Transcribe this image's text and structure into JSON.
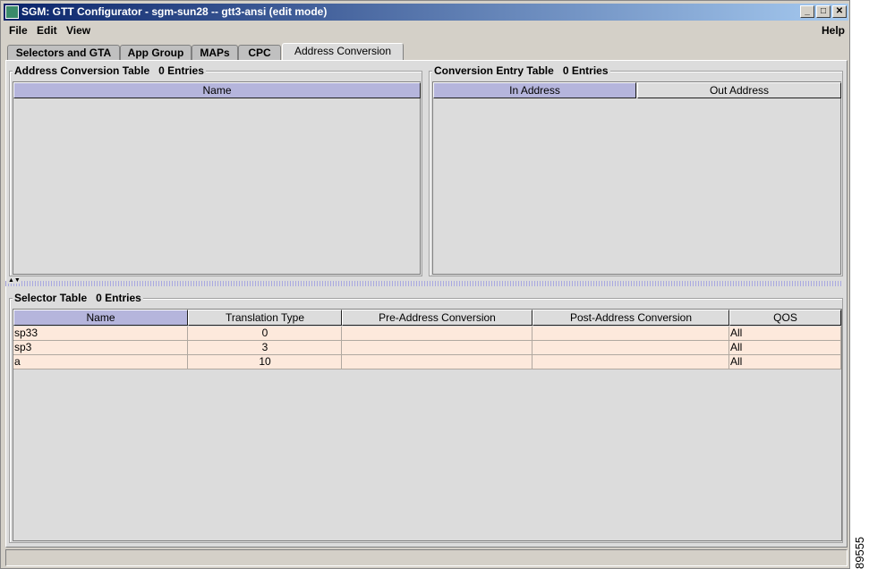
{
  "window": {
    "title": "SGM:  GTT Configurator - sgm-sun28 -- gtt3-ansi (edit mode)",
    "controls": [
      "_",
      "□",
      "✕"
    ]
  },
  "menu": {
    "file": "File",
    "edit": "Edit",
    "view": "View",
    "help": "Help"
  },
  "tabs": [
    "Selectors and GTA",
    "App Group",
    "MAPs",
    "CPC",
    "Address Conversion"
  ],
  "address_table": {
    "title": "Address Conversion Table",
    "count": "0 Entries",
    "columns": [
      "Name"
    ]
  },
  "conversion_table": {
    "title": "Conversion Entry Table",
    "count": "0 Entries",
    "columns": [
      "In Address",
      "Out Address"
    ]
  },
  "selector_table": {
    "title": "Selector Table",
    "count": "0 Entries",
    "columns": [
      "Name",
      "Translation Type",
      "Pre-Address Conversion",
      "Post-Address Conversion",
      "QOS"
    ],
    "rows": [
      [
        "sp33",
        "0",
        "",
        "",
        "All"
      ],
      [
        "sp3",
        "3",
        "",
        "",
        "All"
      ],
      [
        "a",
        "10",
        "",
        "",
        "All"
      ]
    ]
  },
  "figure_code": "89555"
}
